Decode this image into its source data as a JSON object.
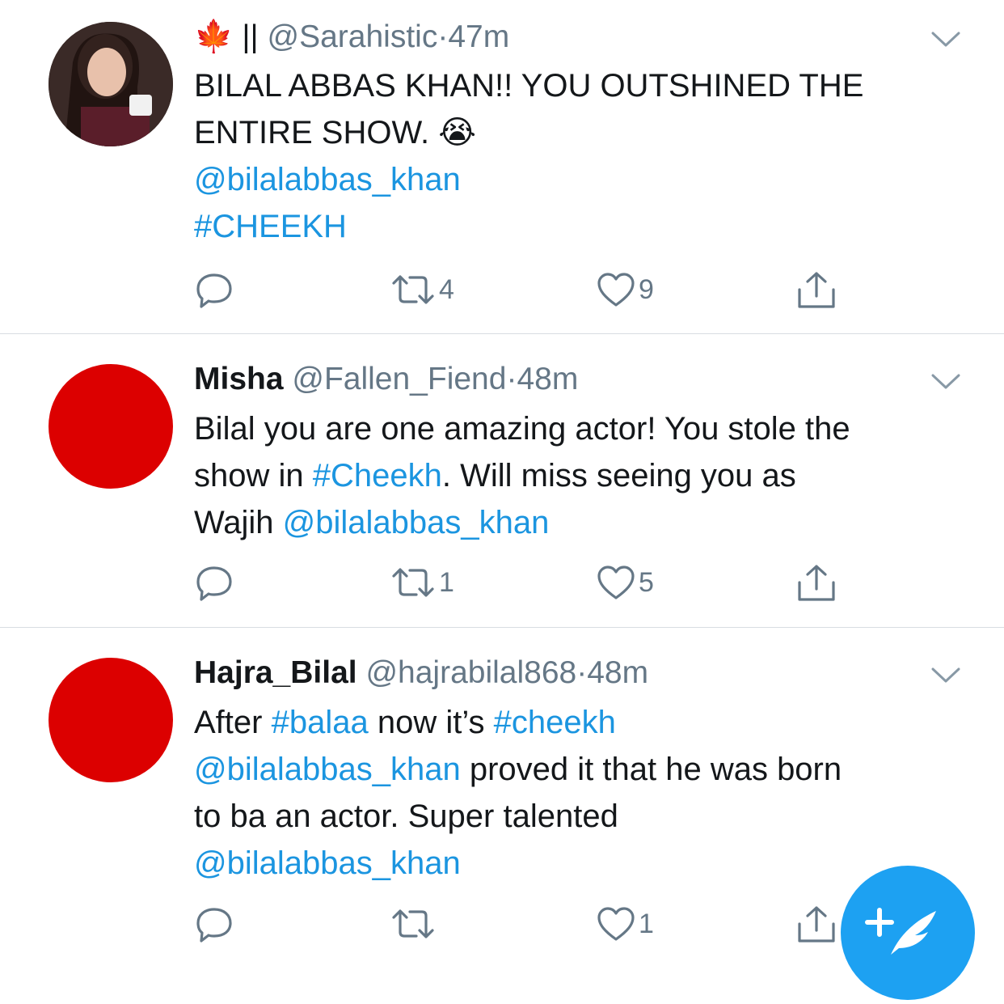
{
  "tweets": [
    {
      "name": "🍁 ||",
      "handle": "@Sarahistic",
      "sep": "·",
      "time": "47m",
      "body_parts": [
        {
          "text": "BILAL ABBAS KHAN!! YOU OUTSHINED THE"
        },
        {
          "text": "ENTIRE SHOW. 😭"
        },
        {
          "text": "@bilalabbas_khan",
          "link": true
        },
        {
          "text": "#CHEEKH",
          "link": true
        }
      ],
      "retweets": "4",
      "likes": "9"
    },
    {
      "name": "Misha",
      "handle": "@Fallen_Fiend",
      "sep": "·",
      "time": "48m",
      "line1": "Bilal you are one amazing actor! You stole the",
      "line2_a": "show in ",
      "line2_link": "#Cheekh",
      "line2_b": ". Will miss seeing you as",
      "line3_a": "Wajih ",
      "line3_link": "@bilalabbas_khan",
      "retweets": "1",
      "likes": "5"
    },
    {
      "name": "Hajra_Bilal",
      "handle": "@hajrabilal868",
      "sep": "·",
      "time": "48m",
      "line1_a": "After ",
      "line1_link1": "#balaa",
      "line1_b": " now it’s ",
      "line1_link2": "#cheekh",
      "line2_link": "@bilalabbas_khan",
      "line2_b": " proved it that he was born",
      "line3": "to ba an actor. Super talented",
      "line4_link": "@bilalabbas_khan",
      "retweets": "",
      "likes": "1"
    }
  ],
  "colors": {
    "accent": "#1b95e0",
    "fab": "#1da1f2",
    "avatar_red": "#dc0000",
    "muted": "#657786",
    "divider": "#d8dde2"
  },
  "icons": [
    "reply-icon",
    "retweet-icon",
    "like-icon",
    "share-icon",
    "chevron-down-icon",
    "compose-icon"
  ]
}
